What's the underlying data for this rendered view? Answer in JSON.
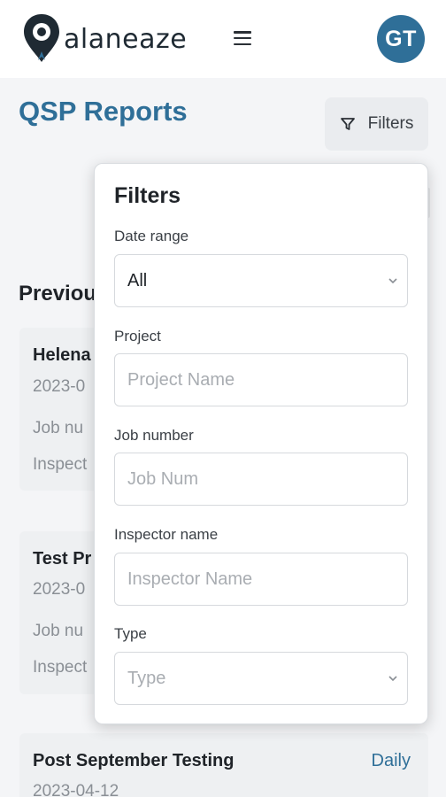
{
  "header": {
    "logo_text": "alaneaze",
    "avatar_initials": "GT"
  },
  "page": {
    "title": "QSP Reports",
    "filters_button_label": "Filters",
    "section_title": "Previou"
  },
  "reports": [
    {
      "title": "Helena",
      "date": "2023-0",
      "job_label": "Job nu",
      "inspector_label": "Inspect"
    },
    {
      "title": "Test Pr",
      "date": "2023-0",
      "job_label": "Job nu",
      "inspector_label": "Inspect"
    },
    {
      "title": "Post September Testing",
      "date": "2023-04-12",
      "type": "Daily"
    }
  ],
  "filters_panel": {
    "title": "Filters",
    "date_range": {
      "label": "Date range",
      "value": "All"
    },
    "project": {
      "label": "Project",
      "placeholder": "Project Name"
    },
    "job_number": {
      "label": "Job number",
      "placeholder": "Job Num"
    },
    "inspector_name": {
      "label": "Inspector name",
      "placeholder": "Inspector Name"
    },
    "type": {
      "label": "Type",
      "placeholder": "Type"
    }
  },
  "colors": {
    "brand_blue": "#2f6f98",
    "background": "#f4f5f7",
    "card_bg": "#eef0f2"
  },
  "icons": [
    "map-pin-logo-icon",
    "hamburger-menu-icon",
    "filter-funnel-icon",
    "chevron-down-icon"
  ]
}
